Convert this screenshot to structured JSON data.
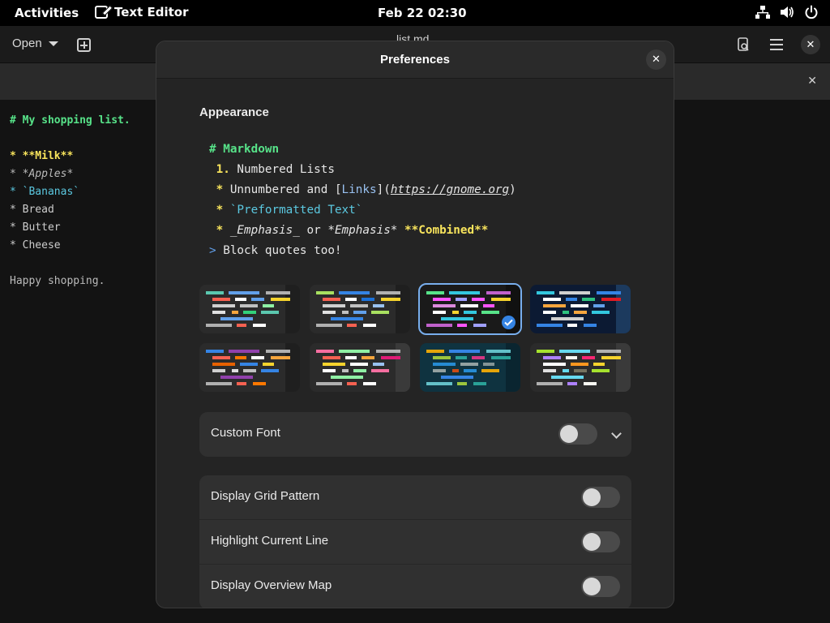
{
  "topbar": {
    "activities": "Activities",
    "app_name": "Text Editor",
    "clock": "Feb 22  02:30",
    "tray_icons": [
      "network-icon",
      "volume-icon",
      "power-icon"
    ]
  },
  "editor": {
    "open_label": "Open",
    "doc_title": "list.md",
    "lines": [
      {
        "text": "# My shopping list.",
        "color": "#57e389",
        "bold": true
      },
      {
        "text": "",
        "color": "#cccccc"
      },
      {
        "text": "* **Milk**",
        "color": "#f8e45c",
        "bold": true
      },
      {
        "text": "* *Apples*",
        "color": "#bbbbbb",
        "italic": true
      },
      {
        "text": "* `Bananas`",
        "color": "#5bc8e0"
      },
      {
        "text": "* Bread",
        "color": "#cccccc"
      },
      {
        "text": "* Butter",
        "color": "#cccccc"
      },
      {
        "text": "* Cheese",
        "color": "#cccccc"
      },
      {
        "text": "",
        "color": "#cccccc"
      },
      {
        "text": "Happy shopping.",
        "color": "#bbbbbb"
      }
    ]
  },
  "preferences": {
    "title": "Preferences",
    "appearance_title": "Appearance",
    "preview": {
      "l1": "# Markdown",
      "l2_num": "1.",
      "l2_text": " Numbered Lists",
      "l3_star": "*",
      "l3_a": " Unnumbered and [",
      "l3_link": "Links",
      "l3_b": "](",
      "l3_url": "https://gnome.org",
      "l3_c": ")",
      "l4_star": "*",
      "l4_code": " `Preformatted Text`",
      "l5_star": "*",
      "l5_em1": " _Emphasis_",
      "l5_or": " or ",
      "l5_em2": "*Emphasis*",
      "l5_bold": " **Combined**",
      "l6_gt": ">",
      "l6_text": " Block quotes too!"
    },
    "schemes": [
      {
        "bg": "#2b2b2b",
        "side": "#1f1f1f",
        "selected": false,
        "colors": [
          "#5bc8af",
          "#62a0ea",
          "#b0b0b0",
          "#f66151",
          "#ffffff",
          "#62a0ea",
          "#f6d32d",
          "#d0d0d0",
          "#c0c0c0",
          "#8ff0a4",
          "#e0e0e0",
          "#f6a53d",
          "#33d17a"
        ]
      },
      {
        "bg": "#2b2b2b",
        "side": "#1f1f1f",
        "selected": false,
        "colors": [
          "#a8e060",
          "#3584e4",
          "#b0b0b0",
          "#f66151",
          "#ffffff",
          "#1c71d8",
          "#f6d32d",
          "#d0d0d0",
          "#c0c0c0",
          "#99c1f1",
          "#e0e0e0",
          "#c0c0c0",
          "#62a0ea"
        ]
      },
      {
        "bg": "#1a1a1a",
        "side": "#111111",
        "selected": true,
        "colors": [
          "#57e389",
          "#33c7de",
          "#c061cb",
          "#ff55ff",
          "#a0a0ff",
          "#ff55ff",
          "#f6d32d",
          "#dc8add",
          "#ffffff",
          "#ff55ff",
          "#ffffff",
          "#f6d32d",
          "#33c7de"
        ]
      },
      {
        "bg": "#0c1a33",
        "side": "#1c3a5e",
        "selected": false,
        "colors": [
          "#33c7de",
          "#d0d0d0",
          "#3584e4",
          "#ffffff",
          "#3584e4",
          "#2ec27e",
          "#e01b24",
          "#f6a53d",
          "#ffffff",
          "#62a0ea",
          "#ffffff",
          "#2ec27e",
          "#f6a53d"
        ]
      },
      {
        "bg": "#2b2b2b",
        "side": "#1f1f1f",
        "selected": false,
        "colors": [
          "#3584e4",
          "#9141ac",
          "#b0b0b0",
          "#f66151",
          "#ff7800",
          "#ffffff",
          "#f6a53d",
          "#e66100",
          "#3584e4",
          "#f6d32d",
          "#d0d0d0",
          "#e0e0e0",
          "#c0c0c0"
        ]
      },
      {
        "bg": "#2b2b2b",
        "side": "#3a3a3a",
        "selected": false,
        "colors": [
          "#f66ea0",
          "#8ff0a4",
          "#b0b0b0",
          "#f66151",
          "#ffffff",
          "#f6a53d",
          "#e01b76",
          "#f6d32d",
          "#ffffff",
          "#99c1f1",
          "#ffffff",
          "#c0c0c0",
          "#8ff0a4"
        ]
      },
      {
        "bg": "#0f3340",
        "side": "#0a2530",
        "selected": false,
        "colors": [
          "#e5a50a",
          "#3584e4",
          "#63c0c8",
          "#9bc53d",
          "#2aa198",
          "#d33682",
          "#2aa198",
          "#268bd2",
          "#93a1a1",
          "#839496",
          "#93a1a1",
          "#cb4b16",
          "#268bd2"
        ]
      },
      {
        "bg": "#2b2b2b",
        "side": "#3a3a3a",
        "selected": false,
        "colors": [
          "#a6e22e",
          "#66d9ef",
          "#b0b0b0",
          "#ae81ff",
          "#f8f8f2",
          "#f92672",
          "#f6d32d",
          "#ffffff",
          "#fd971f",
          "#f6d32d",
          "#e0e0e0",
          "#66d9ef",
          "#75715e"
        ]
      }
    ],
    "custom_font_label": "Custom Font",
    "rows": [
      {
        "label": "Display Grid Pattern",
        "on": false
      },
      {
        "label": "Highlight Current Line",
        "on": false
      },
      {
        "label": "Display Overview Map",
        "on": false
      }
    ]
  }
}
